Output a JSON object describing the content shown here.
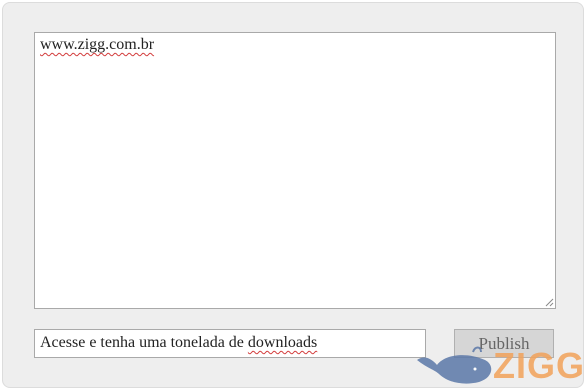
{
  "editor": {
    "content": "www.zigg.com.br"
  },
  "share": {
    "input_value_before": "Acesse e tenha uma tonelada de ",
    "input_value_spell": "downloads",
    "publish_label": "Publish"
  },
  "watermark": {
    "text": "ZIGG",
    "colors": {
      "whale": "#5b78a8",
      "text": "#f2a25a"
    }
  }
}
